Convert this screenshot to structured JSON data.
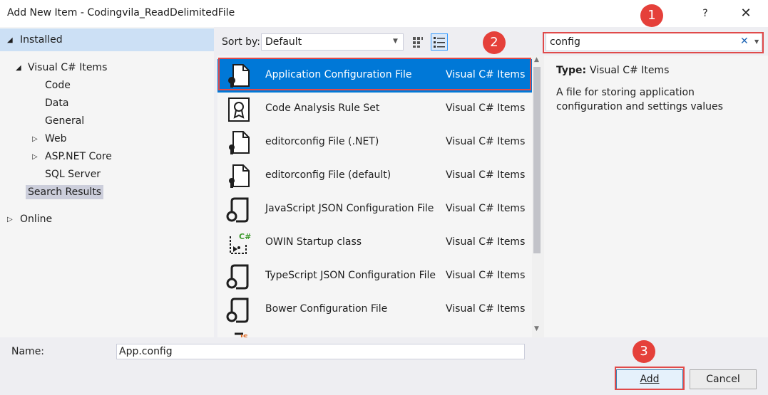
{
  "window": {
    "title": "Add New Item - Codingvila_ReadDelimitedFile",
    "help_glyph": "?",
    "close_glyph": "✕"
  },
  "tree": {
    "installed": "Installed",
    "visual_csharp": "Visual C# Items",
    "children": [
      "Code",
      "Data",
      "General",
      "Web",
      "ASP.NET Core",
      "SQL Server"
    ],
    "search_results": "Search Results",
    "online": "Online"
  },
  "toolbar": {
    "sort_label": "Sort by:",
    "sort_value": "Default"
  },
  "search": {
    "value": "config",
    "clear_glyph": "✕"
  },
  "items": [
    {
      "name": "Application Configuration File",
      "type": "Visual C# Items",
      "icon": "config-file-icon"
    },
    {
      "name": "Code Analysis Rule Set",
      "type": "Visual C# Items",
      "icon": "ruleset-icon"
    },
    {
      "name": "editorconfig File (.NET)",
      "type": "Visual C# Items",
      "icon": "editorconfig-icon"
    },
    {
      "name": "editorconfig File (default)",
      "type": "Visual C# Items",
      "icon": "editorconfig-icon"
    },
    {
      "name": "JavaScript JSON Configuration File",
      "type": "Visual C# Items",
      "icon": "json-config-icon"
    },
    {
      "name": "OWIN Startup class",
      "type": "Visual C# Items",
      "icon": "owin-class-icon"
    },
    {
      "name": "TypeScript JSON Configuration File",
      "type": "Visual C# Items",
      "icon": "json-config-icon"
    },
    {
      "name": "Bower Configuration File",
      "type": "Visual C# Items",
      "icon": "json-config-icon"
    }
  ],
  "details": {
    "type_label": "Type:",
    "type_value": "Visual C# Items",
    "description": "A file for storing application configuration and settings values"
  },
  "footer": {
    "name_label": "Name:",
    "name_value": "App.config",
    "add_label": "Add",
    "cancel_label": "Cancel"
  },
  "badges": [
    "1",
    "2",
    "3"
  ],
  "colors": {
    "selection": "#0078d7",
    "highlight": "#e04a4a",
    "badge": "#e5403a"
  }
}
